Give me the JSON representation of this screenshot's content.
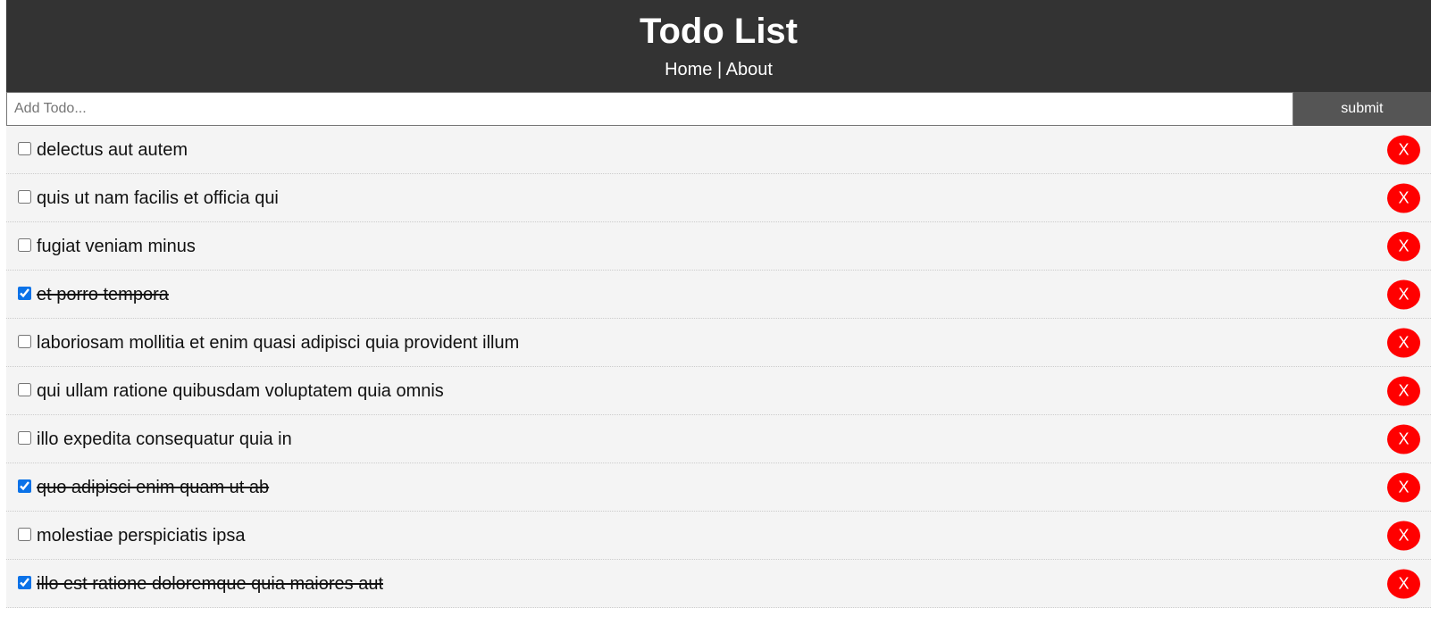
{
  "header": {
    "title": "Todo List",
    "nav": [
      {
        "label": "Home"
      },
      {
        "label": "About"
      }
    ],
    "separator": "|"
  },
  "form": {
    "placeholder": "Add Todo...",
    "value": "",
    "submit_label": "submit"
  },
  "todos": [
    {
      "title": "delectus aut autem",
      "completed": false
    },
    {
      "title": "quis ut nam facilis et officia qui",
      "completed": false
    },
    {
      "title": "fugiat veniam minus",
      "completed": false
    },
    {
      "title": "et porro tempora",
      "completed": true
    },
    {
      "title": "laboriosam mollitia et enim quasi adipisci quia provident illum",
      "completed": false
    },
    {
      "title": "qui ullam ratione quibusdam voluptatem quia omnis",
      "completed": false
    },
    {
      "title": "illo expedita consequatur quia in",
      "completed": false
    },
    {
      "title": "quo adipisci enim quam ut ab",
      "completed": true
    },
    {
      "title": "molestiae perspiciatis ipsa",
      "completed": false
    },
    {
      "title": "illo est ratione doloremque quia maiores aut",
      "completed": true
    }
  ],
  "delete_label": "X",
  "colors": {
    "header_bg": "#333333",
    "submit_bg": "#555555",
    "delete_bg": "#ff0000",
    "item_bg": "#f4f4f4"
  }
}
